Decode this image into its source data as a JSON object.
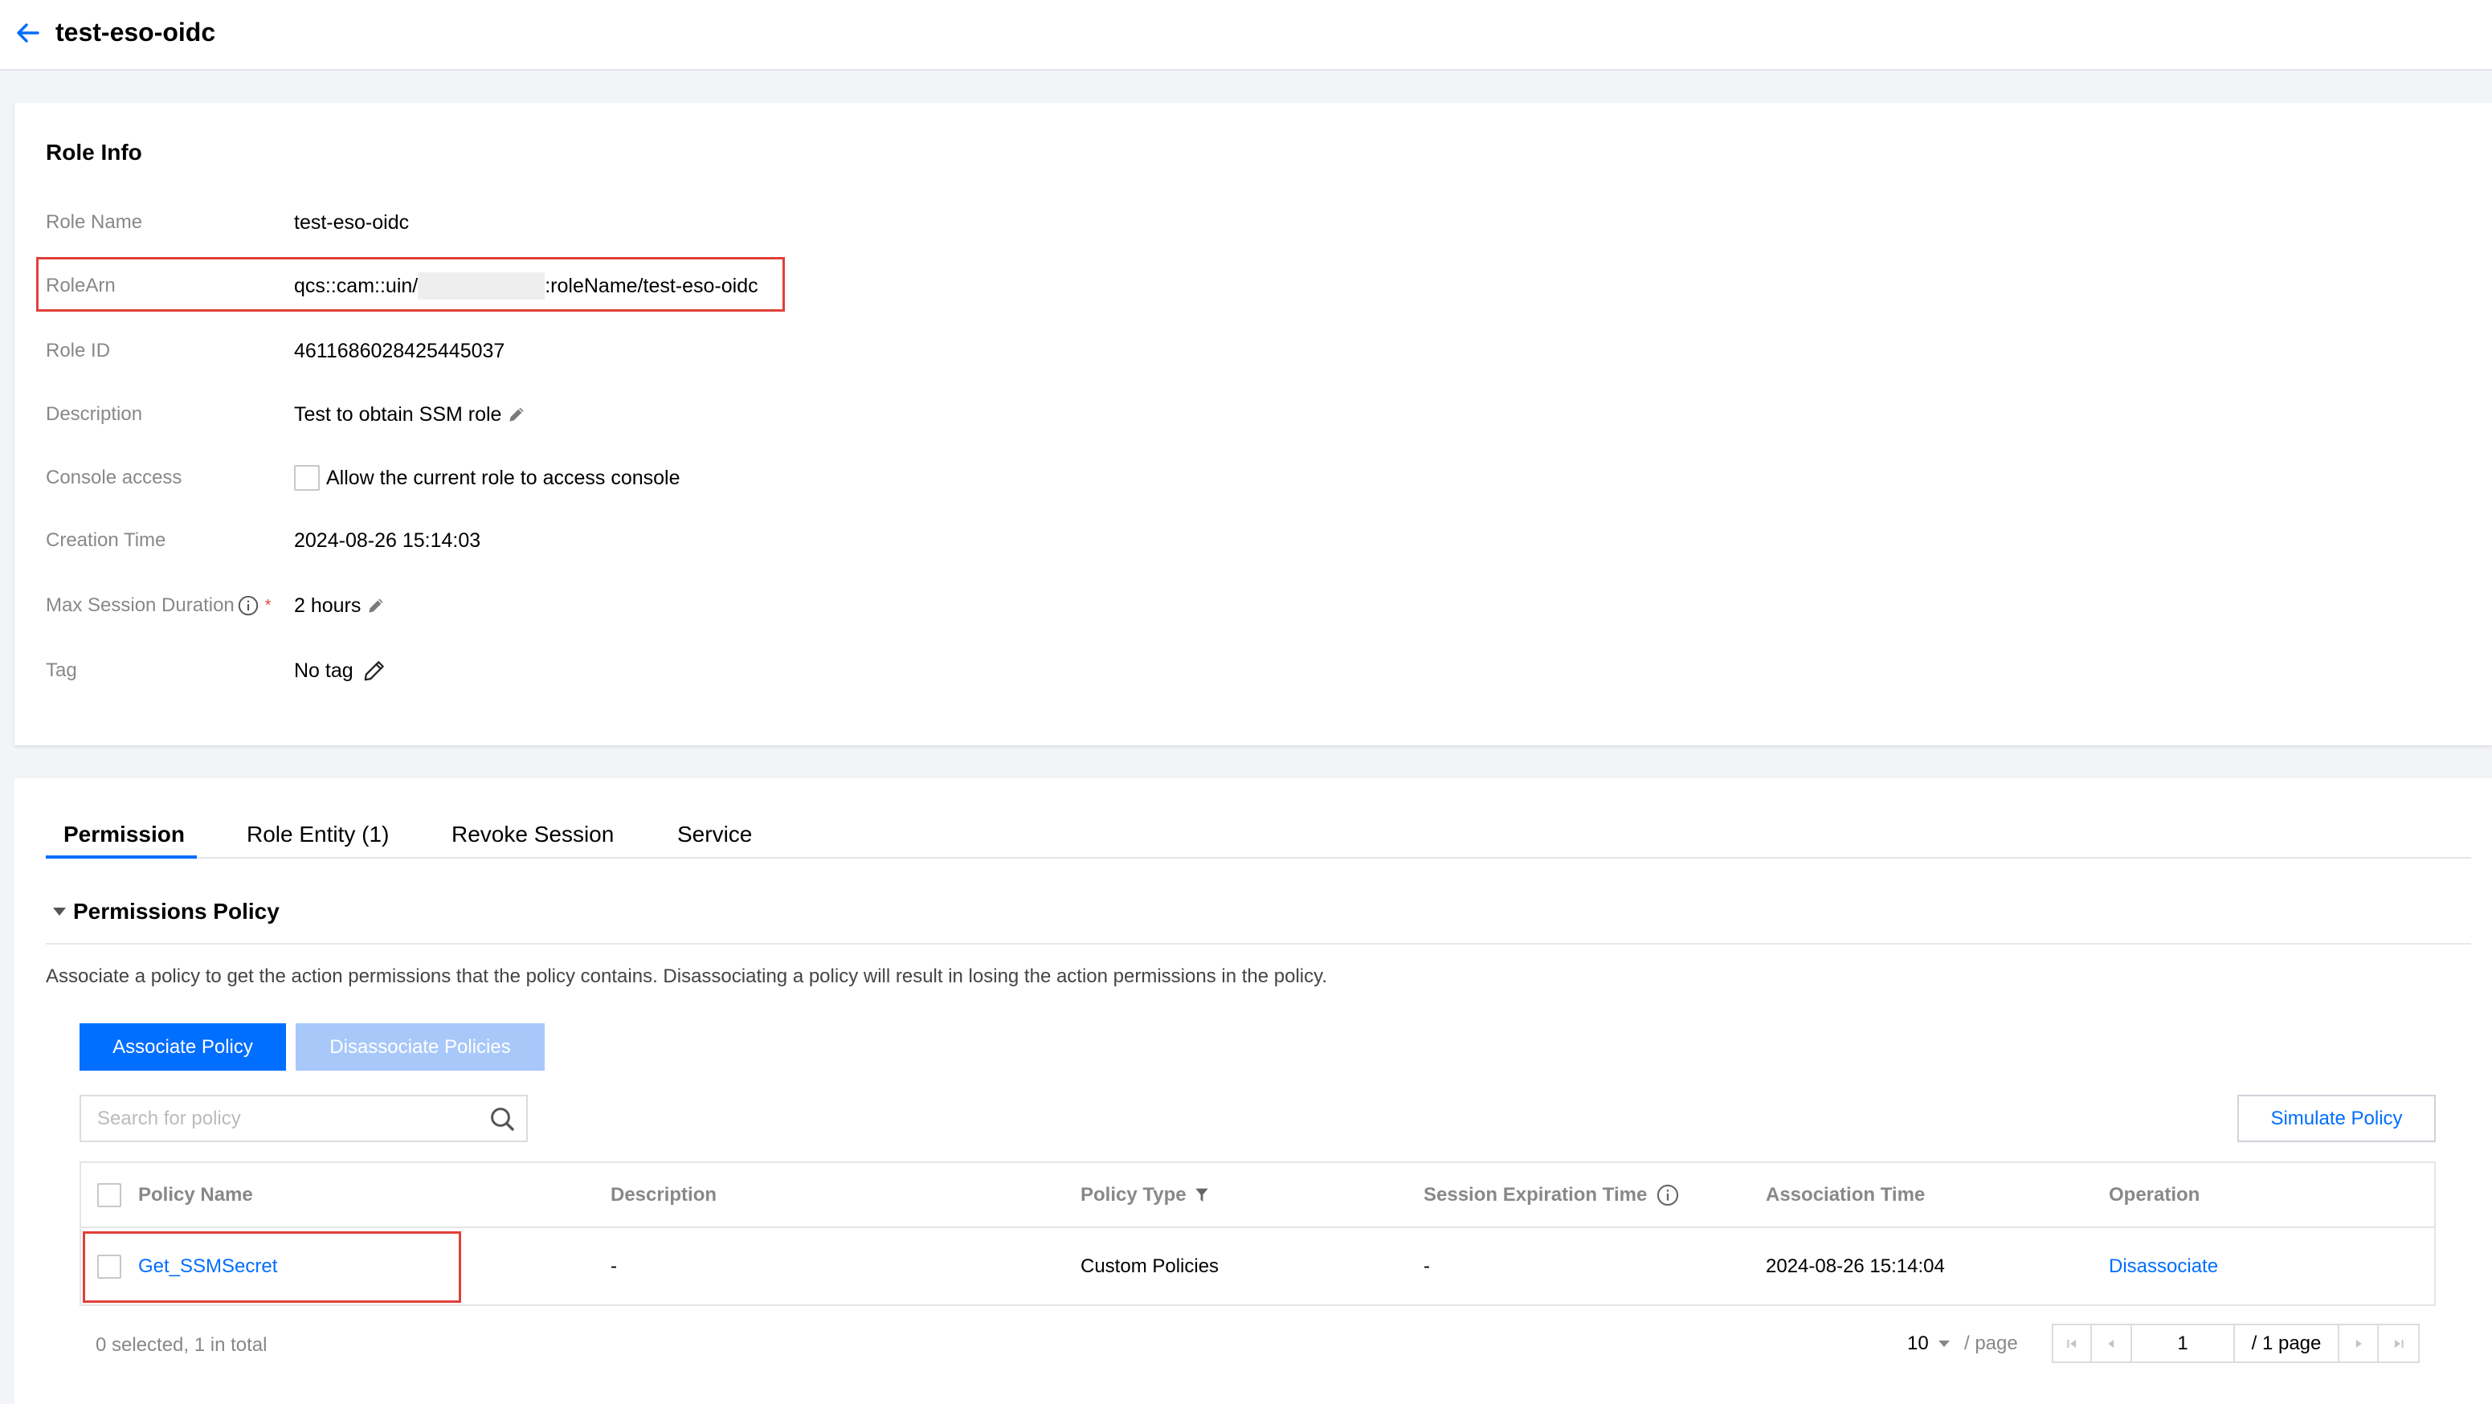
{
  "header": {
    "back_icon": "arrow-left-icon",
    "title": "test-eso-oidc"
  },
  "role_info": {
    "title": "Role Info",
    "role_name": {
      "label": "Role Name",
      "value": "test-eso-oidc"
    },
    "role_arn": {
      "label": "RoleArn",
      "value_prefix": "qcs::cam::uin/",
      "value_suffix": ":roleName/test-eso-oidc"
    },
    "role_id": {
      "label": "Role ID",
      "value": "4611686028425445037"
    },
    "description": {
      "label": "Description",
      "value": "Test to obtain SSM role",
      "edit_icon": "pencil-icon"
    },
    "console_access": {
      "label": "Console access",
      "checkbox_label": "Allow the current role to access console",
      "checked": false
    },
    "creation_time": {
      "label": "Creation Time",
      "value": "2024-08-26 15:14:03"
    },
    "max_session_duration": {
      "label": "Max Session Duration",
      "info_icon": "info-circle-icon",
      "required_mark": "*",
      "value": "2 hours",
      "edit_icon": "pencil-icon"
    },
    "tag": {
      "label": "Tag",
      "value": "No tag",
      "edit_icon": "pencil-outline-icon"
    }
  },
  "tabs": [
    {
      "label": "Permission",
      "active": true
    },
    {
      "label": "Role Entity (1)",
      "active": false
    },
    {
      "label": "Revoke Session",
      "active": false
    },
    {
      "label": "Service",
      "active": false
    }
  ],
  "permissions_policy": {
    "collapse_icon": "caret-down-icon",
    "section_title": "Permissions Policy",
    "description": "Associate a policy to get the action permissions that the policy contains. Disassociating a policy will result in losing the action permissions in the policy.",
    "associate_button": "Associate Policy",
    "disassociate_button": "Disassociate Policies",
    "disassociate_disabled": true,
    "search_placeholder": "Search for policy",
    "search_icon": "search-icon",
    "simulate_button": "Simulate Policy",
    "table": {
      "columns": [
        "Policy Name",
        "Description",
        "Policy Type",
        "Session Expiration Time",
        "Association Time",
        "Operation"
      ],
      "policy_type_icon": "filter-icon",
      "session_expiration_icon": "info-circle-icon",
      "rows": [
        {
          "selected": false,
          "policy_name": "Get_SSMSecret",
          "description": "-",
          "policy_type": "Custom Policies",
          "session_expiration_time": "-",
          "association_time": "2024-08-26 15:14:04",
          "operation": "Disassociate"
        }
      ]
    },
    "footer": {
      "selection_summary": "0 selected, 1 in total"
    },
    "pagination": {
      "page_size": "10",
      "page_size_suffix": "/ page",
      "current_page": "1",
      "total_pages": "/ 1 page",
      "icons": [
        "first-page-icon",
        "prev-page-icon",
        "next-page-icon",
        "last-page-icon"
      ]
    }
  },
  "colors": {
    "primary": "#006eff",
    "disabled_button": "#a8c8fa",
    "highlight_box": "#e0403a",
    "required_mark": "#e54545",
    "page_background": "#f3f4f7"
  }
}
